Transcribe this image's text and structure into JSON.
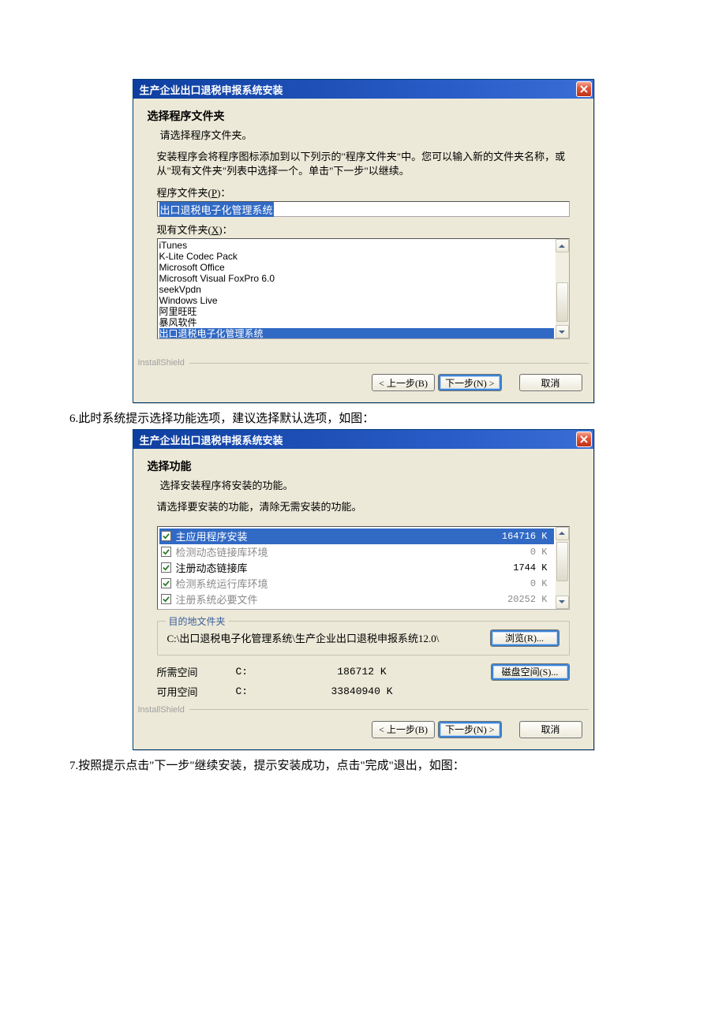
{
  "win1": {
    "title": "生产企业出口退税申报系统安装",
    "heading": "选择程序文件夹",
    "subheading": "请选择程序文件夹。",
    "description": "安装程序会将程序图标添加到以下列示的\"程序文件夹\"中。您可以输入新的文件夹名称，或从\"现有文件夹\"列表中选择一个。单击\"下一步\"以继续。",
    "program_folder_label_pre": "程序文件夹(",
    "program_folder_key": "P",
    "program_folder_label_post": ")：",
    "program_folder_value": "出口退税电子化管理系统",
    "existing_label_pre": "现有文件夹(",
    "existing_key": "X",
    "existing_label_post": ")：",
    "existing_items": [
      "iTunes",
      "K-Lite Codec Pack",
      "Microsoft Office",
      "Microsoft Visual FoxPro 6.0",
      "seekVpdn",
      "Windows Live",
      "阿里旺旺",
      "暴风软件",
      "出口退税电子化管理系统"
    ],
    "brand": "InstallShield",
    "btn_back": "< 上一步(B)",
    "btn_next": "下一步(N) >",
    "btn_cancel": "取消"
  },
  "caption1": "6.此时系统提示选择功能选项，建议选择默认选项，如图：",
  "win2": {
    "title": "生产企业出口退税申报系统安装",
    "heading": "选择功能",
    "subheading": "选择安装程序将安装的功能。",
    "prompt": "请选择要安装的功能，清除无需安装的功能。",
    "features": [
      {
        "label": "主应用程序安装",
        "size": "164716 K",
        "selected": true,
        "disabled": false
      },
      {
        "label": "检测动态链接库环境",
        "size": "0 K",
        "selected": false,
        "disabled": true
      },
      {
        "label": "注册动态链接库",
        "size": "1744 K",
        "selected": false,
        "disabled": false
      },
      {
        "label": "检测系统运行库环境",
        "size": "0 K",
        "selected": false,
        "disabled": true
      },
      {
        "label": "注册系统必要文件",
        "size": "20252 K",
        "selected": false,
        "disabled": true
      }
    ],
    "dest_legend": "目的地文件夹",
    "dest_path": "C:\\出口退税电子化管理系统\\生产企业出口退税申报系统12.0\\",
    "browse_btn": "浏览(R)...",
    "space_req_label": "所需空间",
    "space_req_drive": "C:",
    "space_req_value": "186712 K",
    "space_avail_label": "可用空间",
    "space_avail_drive": "C:",
    "space_avail_value": "33840940 K",
    "disk_btn": "磁盘空间(S)...",
    "brand": "InstallShield",
    "btn_back": "< 上一步(B)",
    "btn_next": "下一步(N) >",
    "btn_cancel": "取消"
  },
  "caption2": "7.按照提示点击\"下一步\"继续安装，提示安装成功，点击\"完成\"退出，如图："
}
